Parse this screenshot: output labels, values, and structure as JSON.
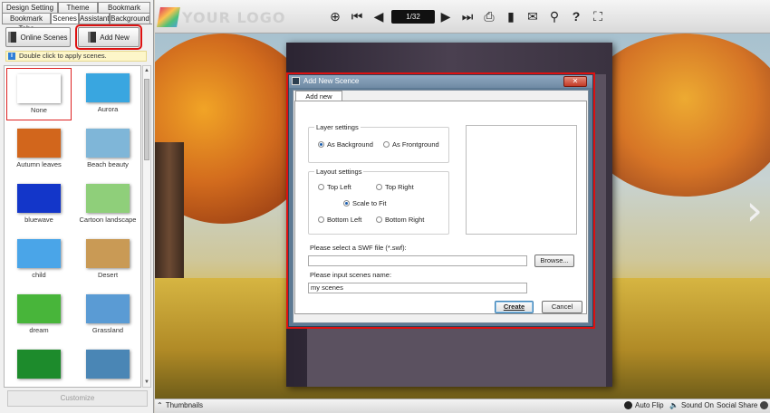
{
  "tabs": {
    "row1": [
      "Design Setting",
      "Theme",
      "Bookmark"
    ],
    "row2": [
      "Bookmark Tabs",
      "Scenes",
      "Assistant",
      "Background"
    ],
    "active": "Scenes"
  },
  "left_toolbar": {
    "online_scenes": "Online Scenes",
    "add_new": "Add New",
    "hint": "Double click to apply scenes.",
    "customize": "Customize"
  },
  "scenes": [
    {
      "label": "None",
      "color": "#ffffff",
      "selected": true
    },
    {
      "label": "Aurora",
      "color": "#39a6e0"
    },
    {
      "label": "Autumn leaves",
      "color": "#d2661c"
    },
    {
      "label": "Beach beauty",
      "color": "#7fb6d8"
    },
    {
      "label": "bluewave",
      "color": "#1336c9"
    },
    {
      "label": "Cartoon landscape",
      "color": "#8fcf7a"
    },
    {
      "label": "child",
      "color": "#4aa5e8"
    },
    {
      "label": "Desert",
      "color": "#c99a55"
    },
    {
      "label": "dream",
      "color": "#48b53a"
    },
    {
      "label": "Grassland",
      "color": "#5a9bd4"
    },
    {
      "label": "",
      "color": "#1d8b2c"
    },
    {
      "label": "",
      "color": "#4a86b5"
    }
  ],
  "viewer": {
    "logo_text": "YOUR LOGO",
    "page_indicator": "1/32",
    "icons": [
      "zoom-in-icon",
      "first-page-icon",
      "prev-page-icon",
      "next-page-icon",
      "last-page-icon",
      "print-icon",
      "bookmark-icon",
      "email-icon",
      "search-icon",
      "help-icon",
      "fullscreen-icon"
    ]
  },
  "statusbar": {
    "thumbnails": "Thumbnails",
    "auto_flip": "Auto Flip",
    "sound_on": "Sound On",
    "social_share": "Social Share"
  },
  "dialog": {
    "title": "Add New Scence",
    "close": "✕",
    "tab": "Add new scene",
    "layer_settings": "Layer settings",
    "as_background": "As Background",
    "as_frontground": "As Frontground",
    "layer_selected": "As Background",
    "layout_settings": "Layout settings",
    "top_left": "Top Left",
    "top_right": "Top Right",
    "scale_to_fit": "Scale to Fit",
    "bottom_left": "Bottom Left",
    "bottom_right": "Bottom Right",
    "layout_selected": "Scale to Fit",
    "swf_label": "Please select  a  SWF file (*.swf):",
    "swf_value": "",
    "browse": "Browse...",
    "name_label": "Please input scenes name:",
    "name_value": "my scenes",
    "create": "Create",
    "cancel": "Cancel"
  },
  "colors": {
    "highlight": "#dd1111",
    "dialog_chrome": "#5d7a94"
  }
}
